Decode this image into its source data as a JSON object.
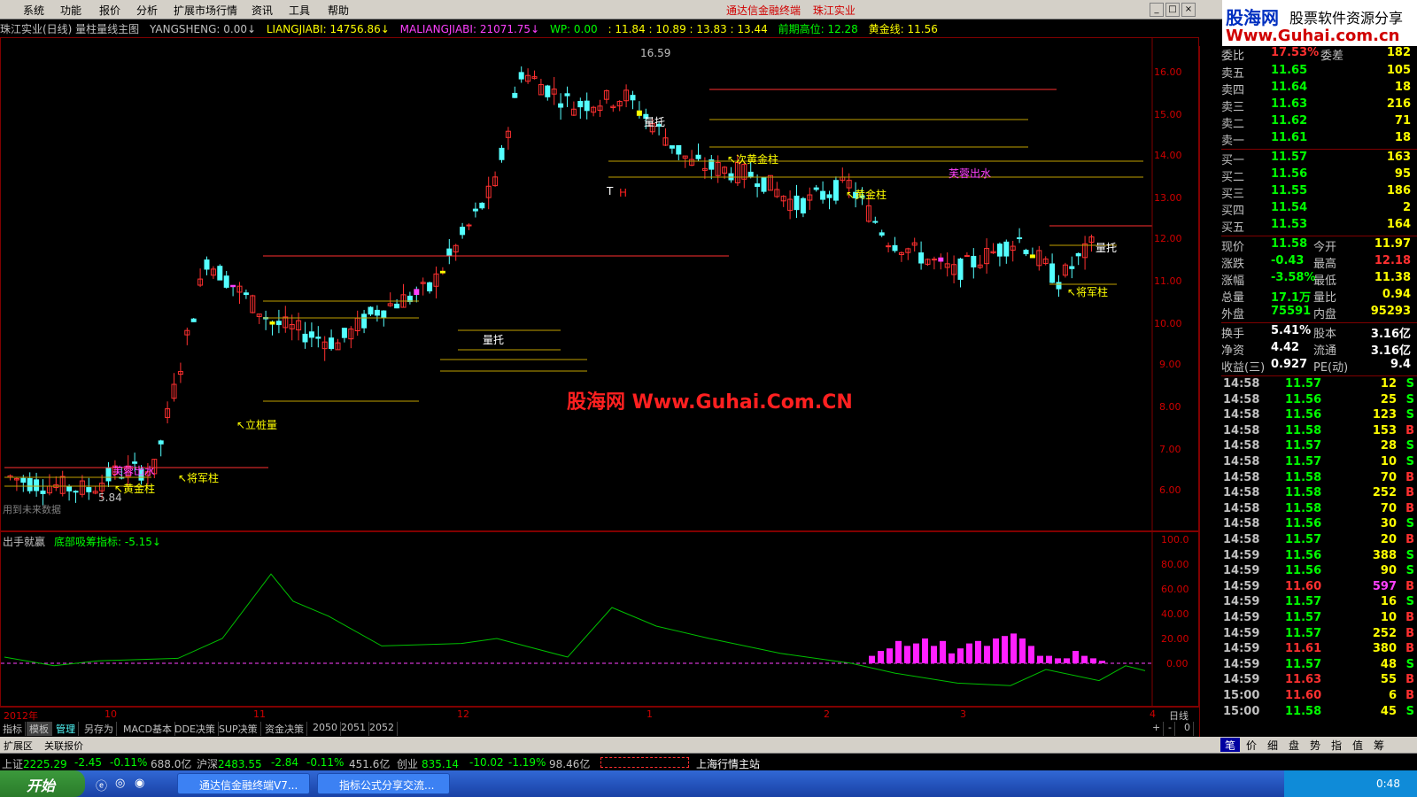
{
  "menu": [
    "系统",
    "功能",
    "报价",
    "分析",
    "扩展市场行情",
    "资讯",
    "工具",
    "帮助"
  ],
  "window_title": "通达信金融终端",
  "window_stock": "珠江实业",
  "logo": {
    "line1": "股海网",
    "line2": "股票软件资源分享",
    "line3": "Www.Guhai.com.cn"
  },
  "infoline": {
    "title": "珠江实业(日线) 量柱量线主图",
    "yangsheng": "YANGSHENG: 0.00↓",
    "liangjiabi": "LIANGJIABI: 14756.86↓",
    "maliangjiabi": "MALIANGJIABI: 21071.75↓",
    "wp": "WP: 0.00",
    "prices": ": 11.84 : 10.89 : 13.83 : 13.44",
    "qianqi": "前期高位: 12.28",
    "huangjinxian": "黄金线: 11.56"
  },
  "main_annotations": [
    {
      "text": "量托",
      "color": "#ffffff"
    },
    {
      "text": "↖次黄金柱",
      "color": "#ffff00"
    },
    {
      "text": "芙蓉出水",
      "color": "#ff40ff"
    },
    {
      "text": "↖黄金柱",
      "color": "#ffff00"
    },
    {
      "text": "↖将军柱",
      "color": "#ffff00"
    },
    {
      "text": "量托",
      "color": "#ffffff"
    },
    {
      "text": "↖立桩量",
      "color": "#ffff00"
    },
    {
      "text": "芙蓉出水",
      "color": "#ff40ff"
    },
    {
      "text": "↖黄金柱",
      "color": "#ffff00"
    },
    {
      "text": "↖将军柱",
      "color": "#ffff00"
    },
    {
      "text": "量托",
      "color": "#ffffff"
    },
    {
      "text": "16.59",
      "color": "#c0c0c0"
    },
    {
      "text": "5.84",
      "color": "#c0c0c0"
    },
    {
      "text": "T",
      "color": "#ffffff"
    },
    {
      "text": "H",
      "color": "#ff2020"
    }
  ],
  "future_note": "用到未来数据",
  "watermark": "股海网 Www.Guhai.Com.CN",
  "price_axis": [
    "16.00",
    "15.00",
    "14.00",
    "13.00",
    "12.00",
    "11.00",
    "10.00",
    "9.00",
    "8.00",
    "7.00",
    "6.00"
  ],
  "sub": {
    "title": "出手就赢",
    "indicator": "底部吸筹指标: -5.15↓"
  },
  "sub_axis": [
    "100.0",
    "80.00",
    "60.00",
    "40.00",
    "20.00",
    "0.00"
  ],
  "time_axis": [
    "2012年",
    "10",
    "11",
    "12",
    "1",
    "2",
    "3",
    "4"
  ],
  "time_axis_right": "日线",
  "tabs": [
    "指标",
    "模板",
    "管理",
    "另存为",
    "MACD基本",
    "DDE决策",
    "SUP决策",
    "资金决策",
    "2050",
    "2051",
    "2052"
  ],
  "tabs_right": [
    "+",
    "-",
    "0"
  ],
  "region2": [
    "扩展区",
    "关联报价"
  ],
  "indices": [
    {
      "name": "上证",
      "val": "2225.29",
      "chg": "-2.45",
      "pct": "-0.11%",
      "amt": "688.0亿"
    },
    {
      "name": "沪深",
      "val": "2483.55",
      "chg": "-2.84",
      "pct": "-0.11%",
      "amt": "451.6亿"
    },
    {
      "name": "创业",
      "val": "835.14",
      "chg": "-10.02",
      "pct": "-1.19%",
      "amt": "98.46亿"
    }
  ],
  "station": "上海行情主站",
  "quote": {
    "weibi": {
      "label": "委比",
      "value": "17.53%",
      "label2": "委差",
      "value2": "182"
    },
    "sells": [
      {
        "label": "卖五",
        "price": "11.65",
        "vol": "105"
      },
      {
        "label": "卖四",
        "price": "11.64",
        "vol": "18"
      },
      {
        "label": "卖三",
        "price": "11.63",
        "vol": "216"
      },
      {
        "label": "卖二",
        "price": "11.62",
        "vol": "71"
      },
      {
        "label": "卖一",
        "price": "11.61",
        "vol": "18"
      }
    ],
    "buys": [
      {
        "label": "买一",
        "price": "11.57",
        "vol": "163"
      },
      {
        "label": "买二",
        "price": "11.56",
        "vol": "95"
      },
      {
        "label": "买三",
        "price": "11.55",
        "vol": "186"
      },
      {
        "label": "买四",
        "price": "11.54",
        "vol": "2"
      },
      {
        "label": "买五",
        "price": "11.53",
        "vol": "164"
      }
    ],
    "stats": [
      {
        "l1": "现价",
        "v1": "11.58",
        "l2": "今开",
        "v2": "11.97"
      },
      {
        "l1": "涨跌",
        "v1": "-0.43",
        "l2": "最高",
        "v2": "12.18"
      },
      {
        "l1": "涨幅",
        "v1": "-3.58%",
        "l2": "最低",
        "v2": "11.38"
      },
      {
        "l1": "总量",
        "v1": "17.1万",
        "l2": "量比",
        "v2": "0.94"
      },
      {
        "l1": "外盘",
        "v1": "75591",
        "l2": "内盘",
        "v2": "95293"
      }
    ],
    "stats2": [
      {
        "l1": "换手",
        "v1": "5.41%",
        "l2": "股本",
        "v2": "3.16亿"
      },
      {
        "l1": "净资",
        "v1": "4.42",
        "l2": "流通",
        "v2": "3.16亿"
      },
      {
        "l1": "收益(三)",
        "v1": "0.927",
        "l2": "PE(动)",
        "v2": "9.4"
      }
    ]
  },
  "ticks": [
    {
      "t": "14:58",
      "p": "11.57",
      "v": "12",
      "bs": "S"
    },
    {
      "t": "14:58",
      "p": "11.56",
      "v": "25",
      "bs": "S"
    },
    {
      "t": "14:58",
      "p": "11.56",
      "v": "123",
      "bs": "S"
    },
    {
      "t": "14:58",
      "p": "11.58",
      "v": "153",
      "bs": "B"
    },
    {
      "t": "14:58",
      "p": "11.57",
      "v": "28",
      "bs": "S"
    },
    {
      "t": "14:58",
      "p": "11.57",
      "v": "10",
      "bs": "S"
    },
    {
      "t": "14:58",
      "p": "11.58",
      "v": "70",
      "bs": "B"
    },
    {
      "t": "14:58",
      "p": "11.58",
      "v": "252",
      "bs": "B"
    },
    {
      "t": "14:58",
      "p": "11.58",
      "v": "70",
      "bs": "B"
    },
    {
      "t": "14:58",
      "p": "11.56",
      "v": "30",
      "bs": "S"
    },
    {
      "t": "14:58",
      "p": "11.57",
      "v": "20",
      "bs": "B"
    },
    {
      "t": "14:59",
      "p": "11.56",
      "v": "388",
      "bs": "S"
    },
    {
      "t": "14:59",
      "p": "11.56",
      "v": "90",
      "bs": "S"
    },
    {
      "t": "14:59",
      "p": "11.60",
      "v": "597",
      "bs": "B"
    },
    {
      "t": "14:59",
      "p": "11.57",
      "v": "16",
      "bs": "S"
    },
    {
      "t": "14:59",
      "p": "11.57",
      "v": "10",
      "bs": "B"
    },
    {
      "t": "14:59",
      "p": "11.57",
      "v": "252",
      "bs": "B"
    },
    {
      "t": "14:59",
      "p": "11.61",
      "v": "380",
      "bs": "B"
    },
    {
      "t": "14:59",
      "p": "11.57",
      "v": "48",
      "bs": "S"
    },
    {
      "t": "14:59",
      "p": "11.63",
      "v": "55",
      "bs": "B"
    },
    {
      "t": "15:00",
      "p": "11.60",
      "v": "6",
      "bs": "B"
    },
    {
      "t": "15:00",
      "p": "11.58",
      "v": "45",
      "bs": "S"
    }
  ],
  "bottom_tabs": [
    "笔",
    "价",
    "细",
    "盘",
    "势",
    "指",
    "值",
    "筹"
  ],
  "taskbar": {
    "start": "开始",
    "items": [
      "通达信金融终端V7...",
      "指标公式分享交流..."
    ],
    "clock": "0:48"
  },
  "colors": {
    "up": "#ff3030",
    "down": "#54ffff",
    "golden": "#ffff00",
    "pink": "#ff40ff",
    "axis": "#800000"
  }
}
